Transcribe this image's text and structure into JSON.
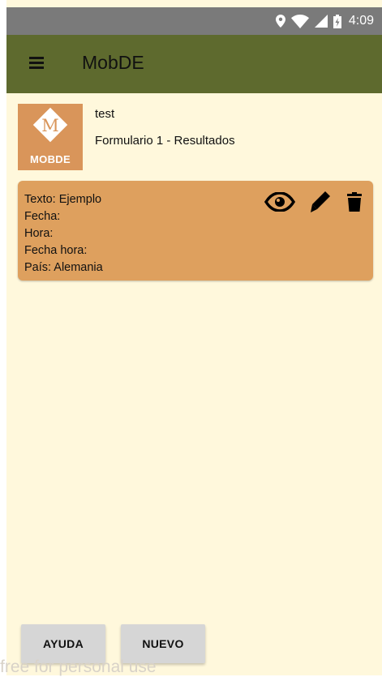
{
  "status_bar": {
    "time": "4:09",
    "icons": [
      "location-icon",
      "wifi-icon",
      "signal-icon",
      "battery-icon"
    ]
  },
  "app_bar": {
    "title": "MobDE",
    "menu_icon": "hamburger-menu-icon",
    "color": "#5e6a2e"
  },
  "header": {
    "logo_letter": "M",
    "logo_text": "MOBDE",
    "username": "test",
    "subtitle": "Formulario 1 - Resultados"
  },
  "result_card": {
    "fields": [
      "Texto: Ejemplo",
      "Fecha:",
      "Hora:",
      "Fecha hora:",
      "País: Alemania"
    ],
    "actions": [
      "eye-icon",
      "pencil-icon",
      "trash-icon"
    ],
    "color": "#dea05e"
  },
  "footer": {
    "help_label": "AYUDA",
    "new_label": "NUEVO",
    "watermark": "free for personal use"
  },
  "colors": {
    "background": "#fff8dc",
    "status_bar": "#7a7a7a",
    "logo": "#d9955a"
  }
}
